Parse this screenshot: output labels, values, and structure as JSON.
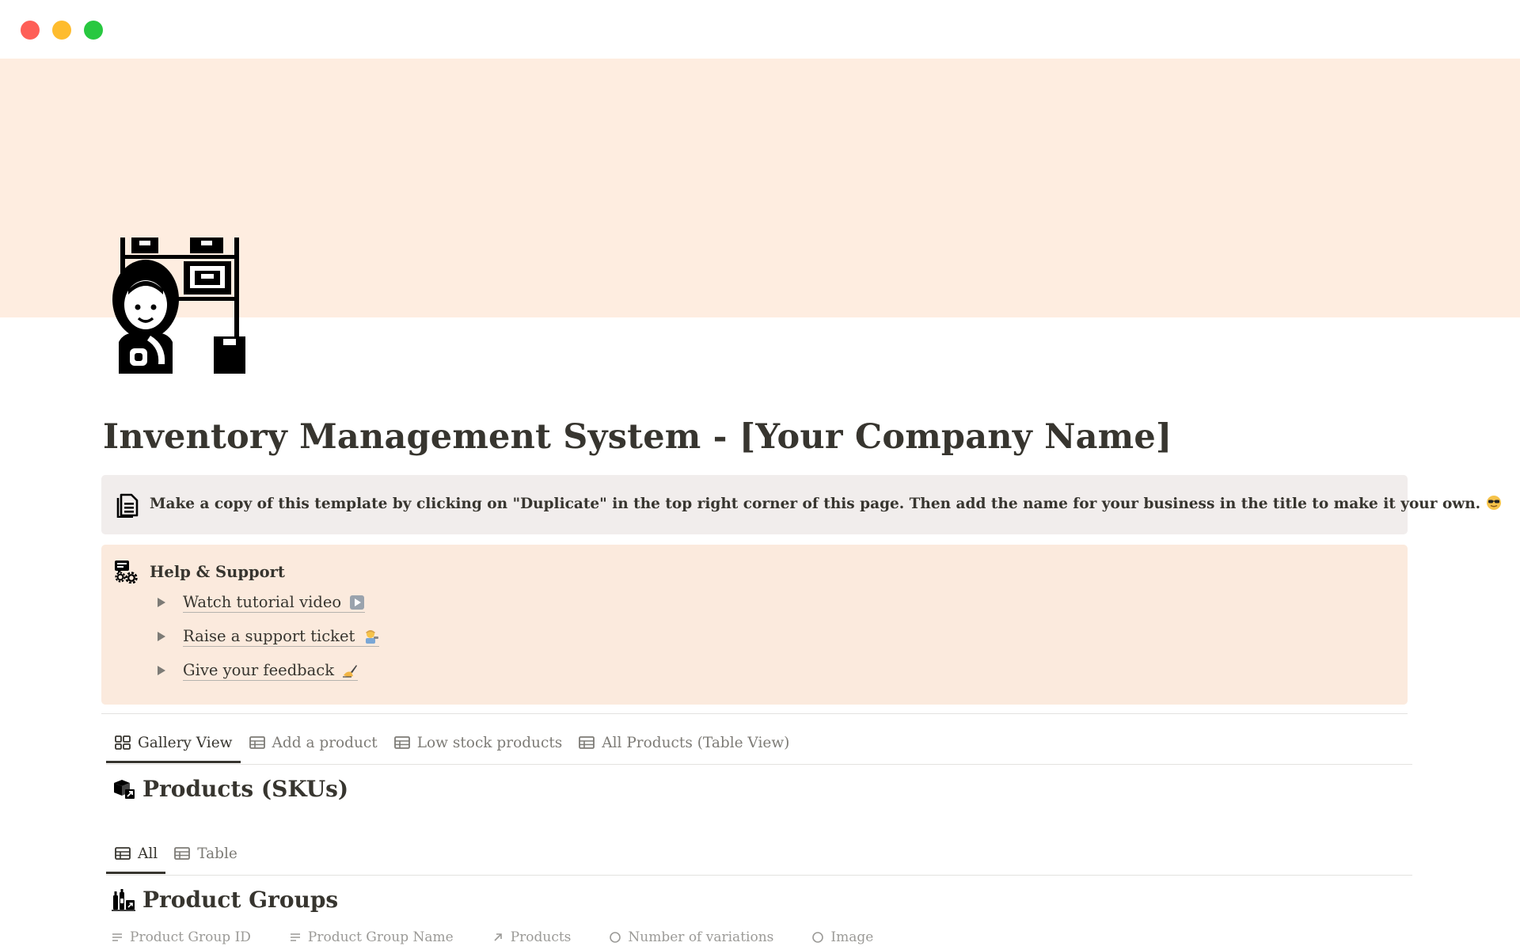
{
  "colors": {
    "cover": "#feede0",
    "callout_gray": "#f1edec",
    "callout_peach": "#fbeadd",
    "text": "#37352f",
    "muted": "#7d7b76"
  },
  "page": {
    "title": "Inventory Management System - [Your Company Name]",
    "icon": "warehouse-worker-icon"
  },
  "callout_duplicate": {
    "icon": "document-icon",
    "text": "Make a copy of this template by clicking on \"Duplicate\" in the top right corner of this page. Then add the name for your business in the title to make it your own."
  },
  "help": {
    "title": "Help & Support",
    "icon": "support-chat-gear-icon",
    "items": [
      {
        "label": "Watch tutorial video",
        "emoji": "play-button-icon"
      },
      {
        "label": "Raise a support ticket",
        "emoji": "technician-icon"
      },
      {
        "label": "Give your feedback",
        "emoji": "writing-hand-icon"
      }
    ]
  },
  "top_tabs": [
    {
      "label": "Gallery View",
      "icon": "gallery-icon",
      "active": true
    },
    {
      "label": "Add a product",
      "icon": "table-icon",
      "active": false
    },
    {
      "label": "Low stock products",
      "icon": "table-icon",
      "active": false
    },
    {
      "label": "All Products (Table View)",
      "icon": "table-icon",
      "active": false
    }
  ],
  "products_section": {
    "title": "Products (SKUs)",
    "icon": "boxes-icon"
  },
  "view_tabs": [
    {
      "label": "All",
      "icon": "table-icon",
      "active": true
    },
    {
      "label": "Table",
      "icon": "table-icon",
      "active": false
    }
  ],
  "product_groups": {
    "title": "Product Groups",
    "icon": "bottles-icon",
    "columns": [
      {
        "label": "Product Group ID",
        "icon": "text-icon"
      },
      {
        "label": "Product Group Name",
        "icon": "text-icon"
      },
      {
        "label": "Products",
        "icon": "relation-icon"
      },
      {
        "label": "Number of variations",
        "icon": "formula-icon"
      },
      {
        "label": "Image",
        "icon": "file-icon"
      }
    ]
  }
}
